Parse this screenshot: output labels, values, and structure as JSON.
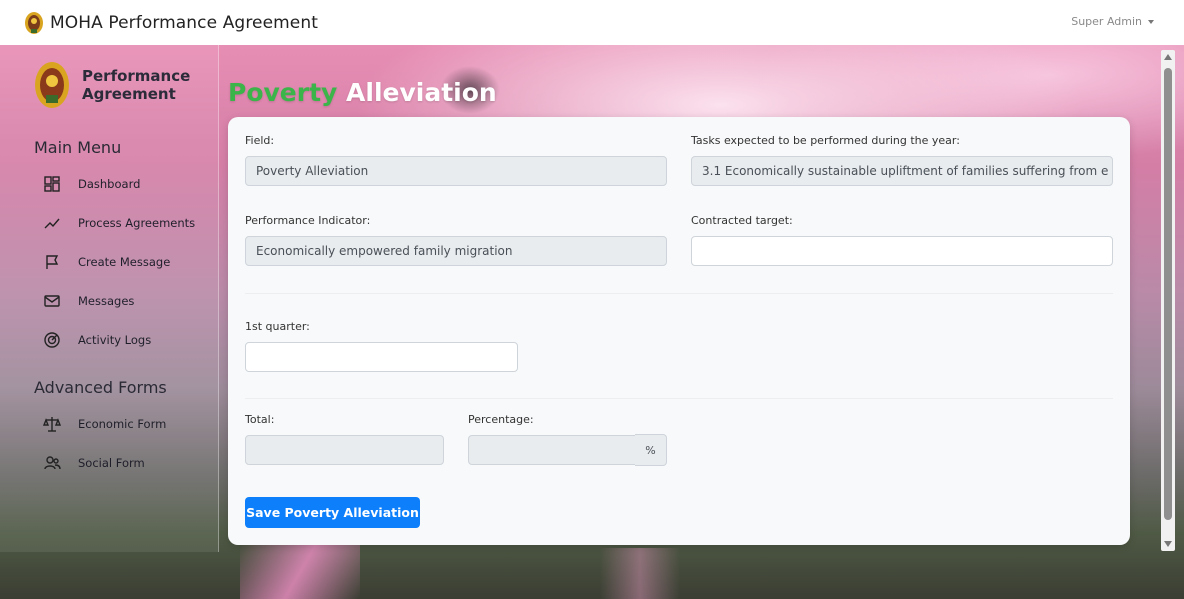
{
  "app": {
    "title": "MOHA Performance Agreement",
    "user": "Super Admin"
  },
  "sidebar": {
    "brand": "Performance Agreement",
    "main_menu_title": "Main Menu",
    "main_items": [
      {
        "label": "Dashboard",
        "icon": "dashboard-icon"
      },
      {
        "label": "Process Agreements",
        "icon": "trend-line-icon"
      },
      {
        "label": "Create Message",
        "icon": "flag-icon"
      },
      {
        "label": "Messages",
        "icon": "envelope-icon"
      },
      {
        "label": "Activity Logs",
        "icon": "radar-icon"
      }
    ],
    "advanced_title": "Advanced Forms",
    "advanced_items": [
      {
        "label": "Economic Form",
        "icon": "scale-icon"
      },
      {
        "label": "Social Form",
        "icon": "users-icon"
      }
    ]
  },
  "page": {
    "title_highlight": "Poverty",
    "title_rest": "Alleviation"
  },
  "form": {
    "field_label": "Field:",
    "field_value": "Poverty Alleviation",
    "tasks_label": "Tasks expected to be performed during the year:",
    "tasks_value": "3.1 Economically sustainable upliftment of families suffering from e",
    "indicator_label": "Performance Indicator:",
    "indicator_value": "Economically empowered family migration",
    "target_label": "Contracted target:",
    "target_value": "",
    "q1_label": "1st quarter:",
    "q1_value": "",
    "total_label": "Total:",
    "total_value": "",
    "percentage_label": "Percentage:",
    "percentage_value": "",
    "percent_addon": "%",
    "save_label": "Save Poverty Alleviation"
  },
  "colors": {
    "accent_blue": "#0d7ffb",
    "title_green": "#3bb54a"
  }
}
